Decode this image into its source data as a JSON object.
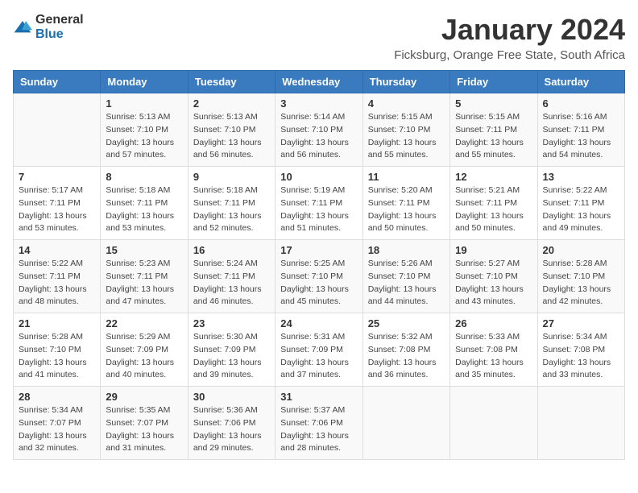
{
  "header": {
    "logo": {
      "text_general": "General",
      "text_blue": "Blue"
    },
    "title": "January 2024",
    "location": "Ficksburg, Orange Free State, South Africa"
  },
  "calendar": {
    "days_of_week": [
      "Sunday",
      "Monday",
      "Tuesday",
      "Wednesday",
      "Thursday",
      "Friday",
      "Saturday"
    ],
    "weeks": [
      [
        {
          "day": "",
          "info": ""
        },
        {
          "day": "1",
          "info": "Sunrise: 5:13 AM\nSunset: 7:10 PM\nDaylight: 13 hours\nand 57 minutes."
        },
        {
          "day": "2",
          "info": "Sunrise: 5:13 AM\nSunset: 7:10 PM\nDaylight: 13 hours\nand 56 minutes."
        },
        {
          "day": "3",
          "info": "Sunrise: 5:14 AM\nSunset: 7:10 PM\nDaylight: 13 hours\nand 56 minutes."
        },
        {
          "day": "4",
          "info": "Sunrise: 5:15 AM\nSunset: 7:10 PM\nDaylight: 13 hours\nand 55 minutes."
        },
        {
          "day": "5",
          "info": "Sunrise: 5:15 AM\nSunset: 7:11 PM\nDaylight: 13 hours\nand 55 minutes."
        },
        {
          "day": "6",
          "info": "Sunrise: 5:16 AM\nSunset: 7:11 PM\nDaylight: 13 hours\nand 54 minutes."
        }
      ],
      [
        {
          "day": "7",
          "info": "Sunrise: 5:17 AM\nSunset: 7:11 PM\nDaylight: 13 hours\nand 53 minutes."
        },
        {
          "day": "8",
          "info": "Sunrise: 5:18 AM\nSunset: 7:11 PM\nDaylight: 13 hours\nand 53 minutes."
        },
        {
          "day": "9",
          "info": "Sunrise: 5:18 AM\nSunset: 7:11 PM\nDaylight: 13 hours\nand 52 minutes."
        },
        {
          "day": "10",
          "info": "Sunrise: 5:19 AM\nSunset: 7:11 PM\nDaylight: 13 hours\nand 51 minutes."
        },
        {
          "day": "11",
          "info": "Sunrise: 5:20 AM\nSunset: 7:11 PM\nDaylight: 13 hours\nand 50 minutes."
        },
        {
          "day": "12",
          "info": "Sunrise: 5:21 AM\nSunset: 7:11 PM\nDaylight: 13 hours\nand 50 minutes."
        },
        {
          "day": "13",
          "info": "Sunrise: 5:22 AM\nSunset: 7:11 PM\nDaylight: 13 hours\nand 49 minutes."
        }
      ],
      [
        {
          "day": "14",
          "info": "Sunrise: 5:22 AM\nSunset: 7:11 PM\nDaylight: 13 hours\nand 48 minutes."
        },
        {
          "day": "15",
          "info": "Sunrise: 5:23 AM\nSunset: 7:11 PM\nDaylight: 13 hours\nand 47 minutes."
        },
        {
          "day": "16",
          "info": "Sunrise: 5:24 AM\nSunset: 7:11 PM\nDaylight: 13 hours\nand 46 minutes."
        },
        {
          "day": "17",
          "info": "Sunrise: 5:25 AM\nSunset: 7:10 PM\nDaylight: 13 hours\nand 45 minutes."
        },
        {
          "day": "18",
          "info": "Sunrise: 5:26 AM\nSunset: 7:10 PM\nDaylight: 13 hours\nand 44 minutes."
        },
        {
          "day": "19",
          "info": "Sunrise: 5:27 AM\nSunset: 7:10 PM\nDaylight: 13 hours\nand 43 minutes."
        },
        {
          "day": "20",
          "info": "Sunrise: 5:28 AM\nSunset: 7:10 PM\nDaylight: 13 hours\nand 42 minutes."
        }
      ],
      [
        {
          "day": "21",
          "info": "Sunrise: 5:28 AM\nSunset: 7:10 PM\nDaylight: 13 hours\nand 41 minutes."
        },
        {
          "day": "22",
          "info": "Sunrise: 5:29 AM\nSunset: 7:09 PM\nDaylight: 13 hours\nand 40 minutes."
        },
        {
          "day": "23",
          "info": "Sunrise: 5:30 AM\nSunset: 7:09 PM\nDaylight: 13 hours\nand 39 minutes."
        },
        {
          "day": "24",
          "info": "Sunrise: 5:31 AM\nSunset: 7:09 PM\nDaylight: 13 hours\nand 37 minutes."
        },
        {
          "day": "25",
          "info": "Sunrise: 5:32 AM\nSunset: 7:08 PM\nDaylight: 13 hours\nand 36 minutes."
        },
        {
          "day": "26",
          "info": "Sunrise: 5:33 AM\nSunset: 7:08 PM\nDaylight: 13 hours\nand 35 minutes."
        },
        {
          "day": "27",
          "info": "Sunrise: 5:34 AM\nSunset: 7:08 PM\nDaylight: 13 hours\nand 33 minutes."
        }
      ],
      [
        {
          "day": "28",
          "info": "Sunrise: 5:34 AM\nSunset: 7:07 PM\nDaylight: 13 hours\nand 32 minutes."
        },
        {
          "day": "29",
          "info": "Sunrise: 5:35 AM\nSunset: 7:07 PM\nDaylight: 13 hours\nand 31 minutes."
        },
        {
          "day": "30",
          "info": "Sunrise: 5:36 AM\nSunset: 7:06 PM\nDaylight: 13 hours\nand 29 minutes."
        },
        {
          "day": "31",
          "info": "Sunrise: 5:37 AM\nSunset: 7:06 PM\nDaylight: 13 hours\nand 28 minutes."
        },
        {
          "day": "",
          "info": ""
        },
        {
          "day": "",
          "info": ""
        },
        {
          "day": "",
          "info": ""
        }
      ]
    ]
  }
}
